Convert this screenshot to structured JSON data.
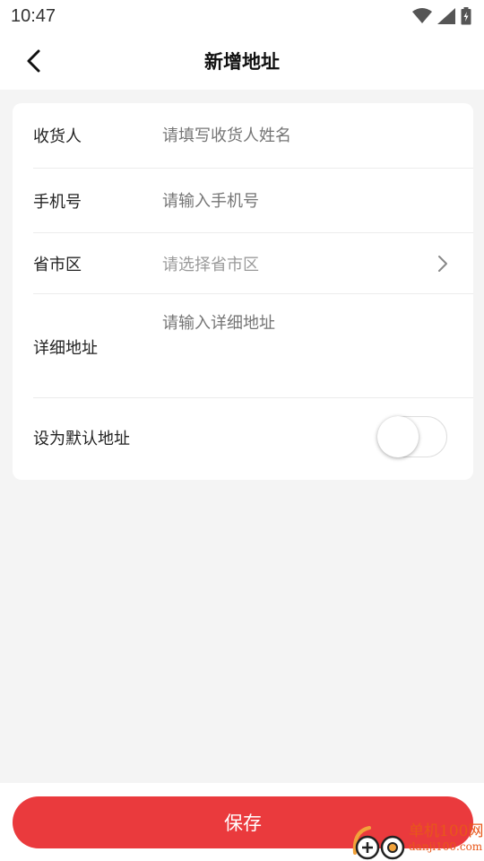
{
  "status_bar": {
    "time": "10:47"
  },
  "header": {
    "title": "新增地址"
  },
  "form": {
    "receiver": {
      "label": "收货人",
      "placeholder": "请填写收货人姓名"
    },
    "phone": {
      "label": "手机号",
      "placeholder": "请输入手机号"
    },
    "region": {
      "label": "省市区",
      "placeholder": "请选择省市区"
    },
    "detail": {
      "label": "详细地址",
      "placeholder": "请输入详细地址"
    },
    "default": {
      "label": "设为默认地址",
      "enabled": false
    }
  },
  "footer": {
    "save_label": "保存"
  },
  "watermark": {
    "name": "单机100网",
    "url": "danji100.com"
  },
  "colors": {
    "accent": "#ea3a3d",
    "background": "#f4f4f4",
    "placeholder": "#9a9a9a",
    "watermark": "#e8571a"
  }
}
